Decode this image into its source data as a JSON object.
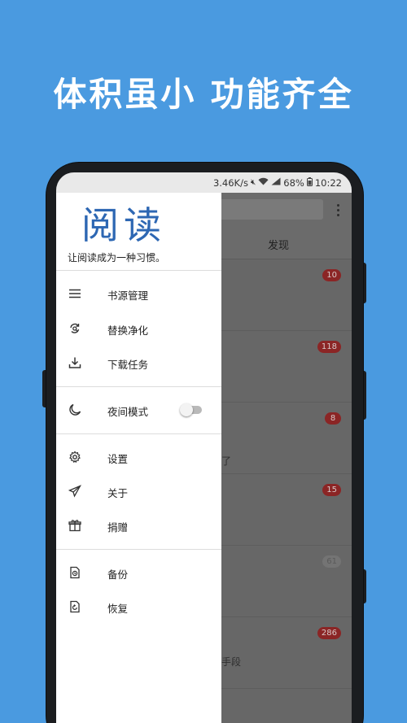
{
  "headline": "体积虽小  功能齐全",
  "status_bar": {
    "speed": "3.46K/s",
    "battery": "68%",
    "time": "10:22"
  },
  "app": {
    "tab_discover": "发现",
    "list_badges": [
      "10",
      "118",
      "8",
      "15",
      "61",
      "286"
    ],
    "list_snippets": [
      "了",
      "手段"
    ]
  },
  "drawer": {
    "logo": "阅读",
    "slogan": "让阅读成为一种习惯。",
    "items": [
      {
        "label": "书源管理",
        "icon": "list-icon"
      },
      {
        "label": "替换净化",
        "icon": "refresh-search-icon"
      },
      {
        "label": "下载任务",
        "icon": "download-icon"
      },
      {
        "label": "夜间模式",
        "icon": "moon-icon"
      },
      {
        "label": "设置",
        "icon": "gear-icon"
      },
      {
        "label": "关于",
        "icon": "paper-plane-icon"
      },
      {
        "label": "捐赠",
        "icon": "gift-icon"
      },
      {
        "label": "备份",
        "icon": "backup-icon"
      },
      {
        "label": "恢复",
        "icon": "restore-icon"
      }
    ],
    "night_mode_on": false
  }
}
